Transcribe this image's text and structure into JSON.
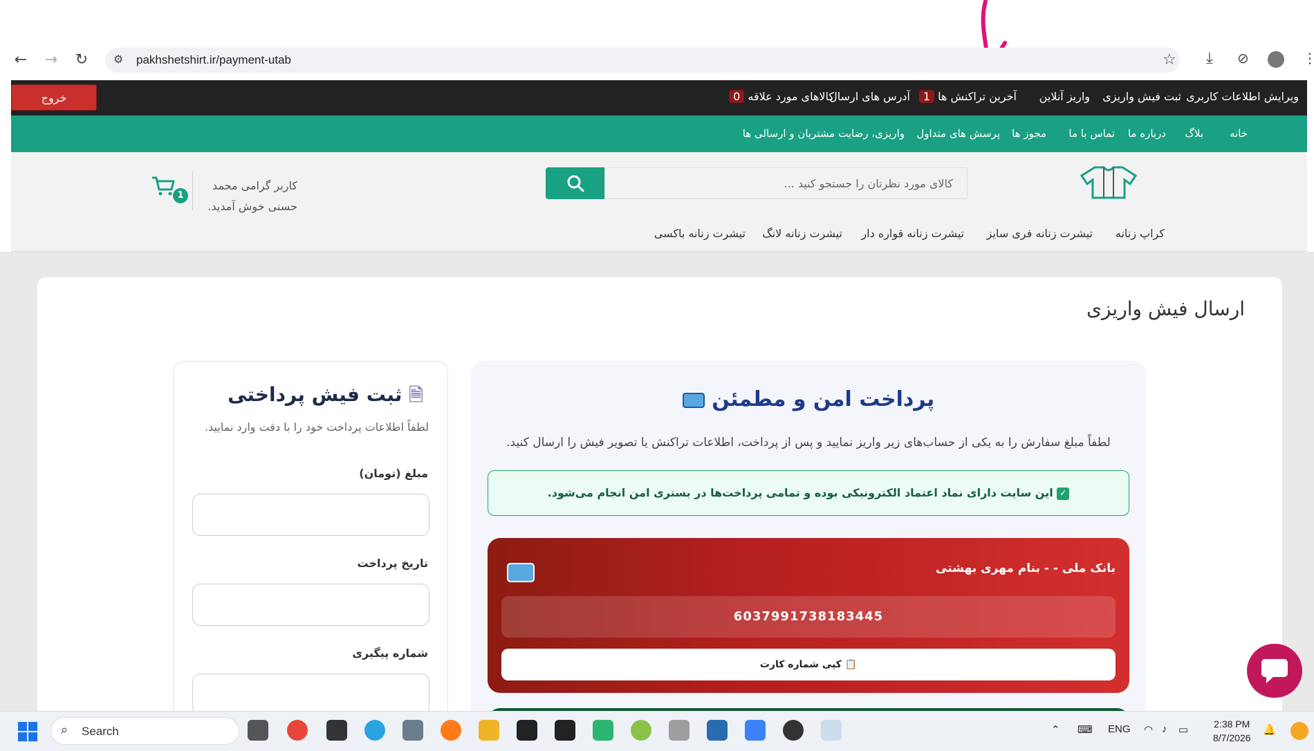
{
  "browser": {
    "url": "pakhshetshirt.ir/payment-utab"
  },
  "topnav": {
    "items": [
      "ویرایش اطلاعات کاربری",
      "ثبت فیش واریزی",
      "واریز آنلاین",
      "آخرین تراکنش ها",
      "آدرس های ارسال",
      "کالاهای مورد علاقه"
    ],
    "transactions_badge": "1",
    "favorites_badge": "0",
    "logout": "خروج"
  },
  "greennav": {
    "items": [
      "خانه",
      "بلاگ",
      "درباره ما",
      "تماس با ما",
      "مجوز ها",
      "پرسش های متداول",
      "واریزی، رضایت مشتریان و ارسالی ها"
    ]
  },
  "header": {
    "search_placeholder": "کالای مورد نظرتان را جستجو کنید ...",
    "greeting_line1": "کاربر گرامی محمد",
    "greeting_line2": "حسنی خوش آمدید.",
    "cart_count": "1"
  },
  "categories": [
    "کراپ زنانه",
    "تیشرت زنانه فری سایز",
    "تیشرت زنانه قواره دار",
    "تیشرت زنانه لانگ",
    "تیشرت زنانه باکسی"
  ],
  "page": {
    "title": "ارسال فیش واریزی"
  },
  "form": {
    "title": "ثبت فیش پرداختی",
    "subtitle": "لطفاً اطلاعات پرداخت خود را با دقت وارد نمایید.",
    "amount_label": "مبلغ (تومان)",
    "date_label": "تاریخ پرداخت",
    "tracking_label": "شماره پیگیری"
  },
  "payment": {
    "title": "پرداخت امن و مطمئن",
    "description": "لطفاً مبلغ سفارش را به یکی از حساب‌های زیر واریز نمایید و پس از پرداخت، اطلاعات تراکنش یا تصویر فیش را ارسال کنید.",
    "secure_note": "این سایت دارای نماد اعتماد الکترونیکی بوده و تمامی پرداخت‌ها در بستری امن انجام می‌شود.",
    "bank_name": "بانک ملی - - بنام مهری بهشتی",
    "card_number": "6037991738183445",
    "copy_button": "کپی شماره کارت"
  },
  "taskbar": {
    "search": "Search",
    "lang": "ENG",
    "time": "2:38 PM",
    "date": "8/7/2026"
  },
  "colors": {
    "brand_green": "#1aa083",
    "topnav_bg": "#222222",
    "logout_red": "#c9302c",
    "bank_red": "#b51f1f",
    "title_blue": "#1e3a8a"
  }
}
